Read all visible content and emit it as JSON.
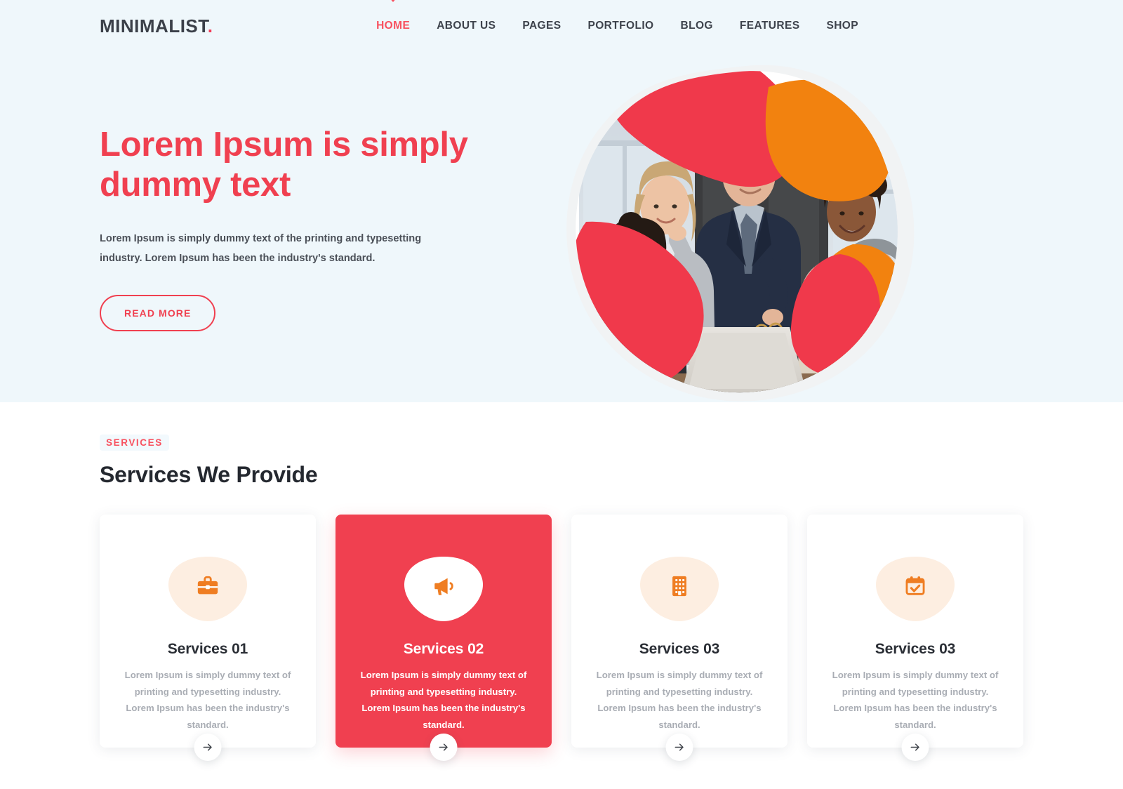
{
  "brand": {
    "name": "MINIMALIST",
    "dot": "."
  },
  "nav": {
    "items": [
      {
        "label": "HOME",
        "active": true
      },
      {
        "label": "ABOUT US",
        "active": false
      },
      {
        "label": "PAGES",
        "active": false
      },
      {
        "label": "PORTFOLIO",
        "active": false
      },
      {
        "label": "BLOG",
        "active": false
      },
      {
        "label": "FEATURES",
        "active": false
      },
      {
        "label": "SHOP",
        "active": false
      }
    ]
  },
  "hero": {
    "title": "Lorem Ipsum is simply dummy text",
    "paragraph": "Lorem Ipsum is simply dummy text of the printing and typesetting industry. Lorem Ipsum has been the industry's standard.",
    "button_label": "READ MORE",
    "image_alt": "business-team-around-laptop"
  },
  "services": {
    "eyebrow": "SERVICES",
    "title": "Services We Provide",
    "cards": [
      {
        "icon": "briefcase-icon",
        "title": "Services 01",
        "text": "Lorem Ipsum is simply dummy text of printing and typesetting industry. Lorem Ipsum has been the industry's standard.",
        "active": false
      },
      {
        "icon": "megaphone-icon",
        "title": "Services 02",
        "text": "Lorem Ipsum is simply dummy text of printing and typesetting industry. Lorem Ipsum has been the industry's standard.",
        "active": true
      },
      {
        "icon": "building-icon",
        "title": "Services 03",
        "text": "Lorem Ipsum is simply dummy text of printing and typesetting industry. Lorem Ipsum has been the industry's standard.",
        "active": false
      },
      {
        "icon": "calendar-check-icon",
        "title": "Services 03",
        "text": "Lorem Ipsum is simply dummy text of printing and typesetting industry. Lorem Ipsum has been the industry's standard.",
        "active": false
      }
    ],
    "arrow_icon": "arrow-right-icon"
  },
  "colors": {
    "brand_red": "#f04050",
    "accent_red": "#f8515f",
    "accent_orange": "#f07d25",
    "hero_bg": "#eff7fb",
    "heading_dark": "#24282f",
    "body_gray": "#a9adb4"
  }
}
